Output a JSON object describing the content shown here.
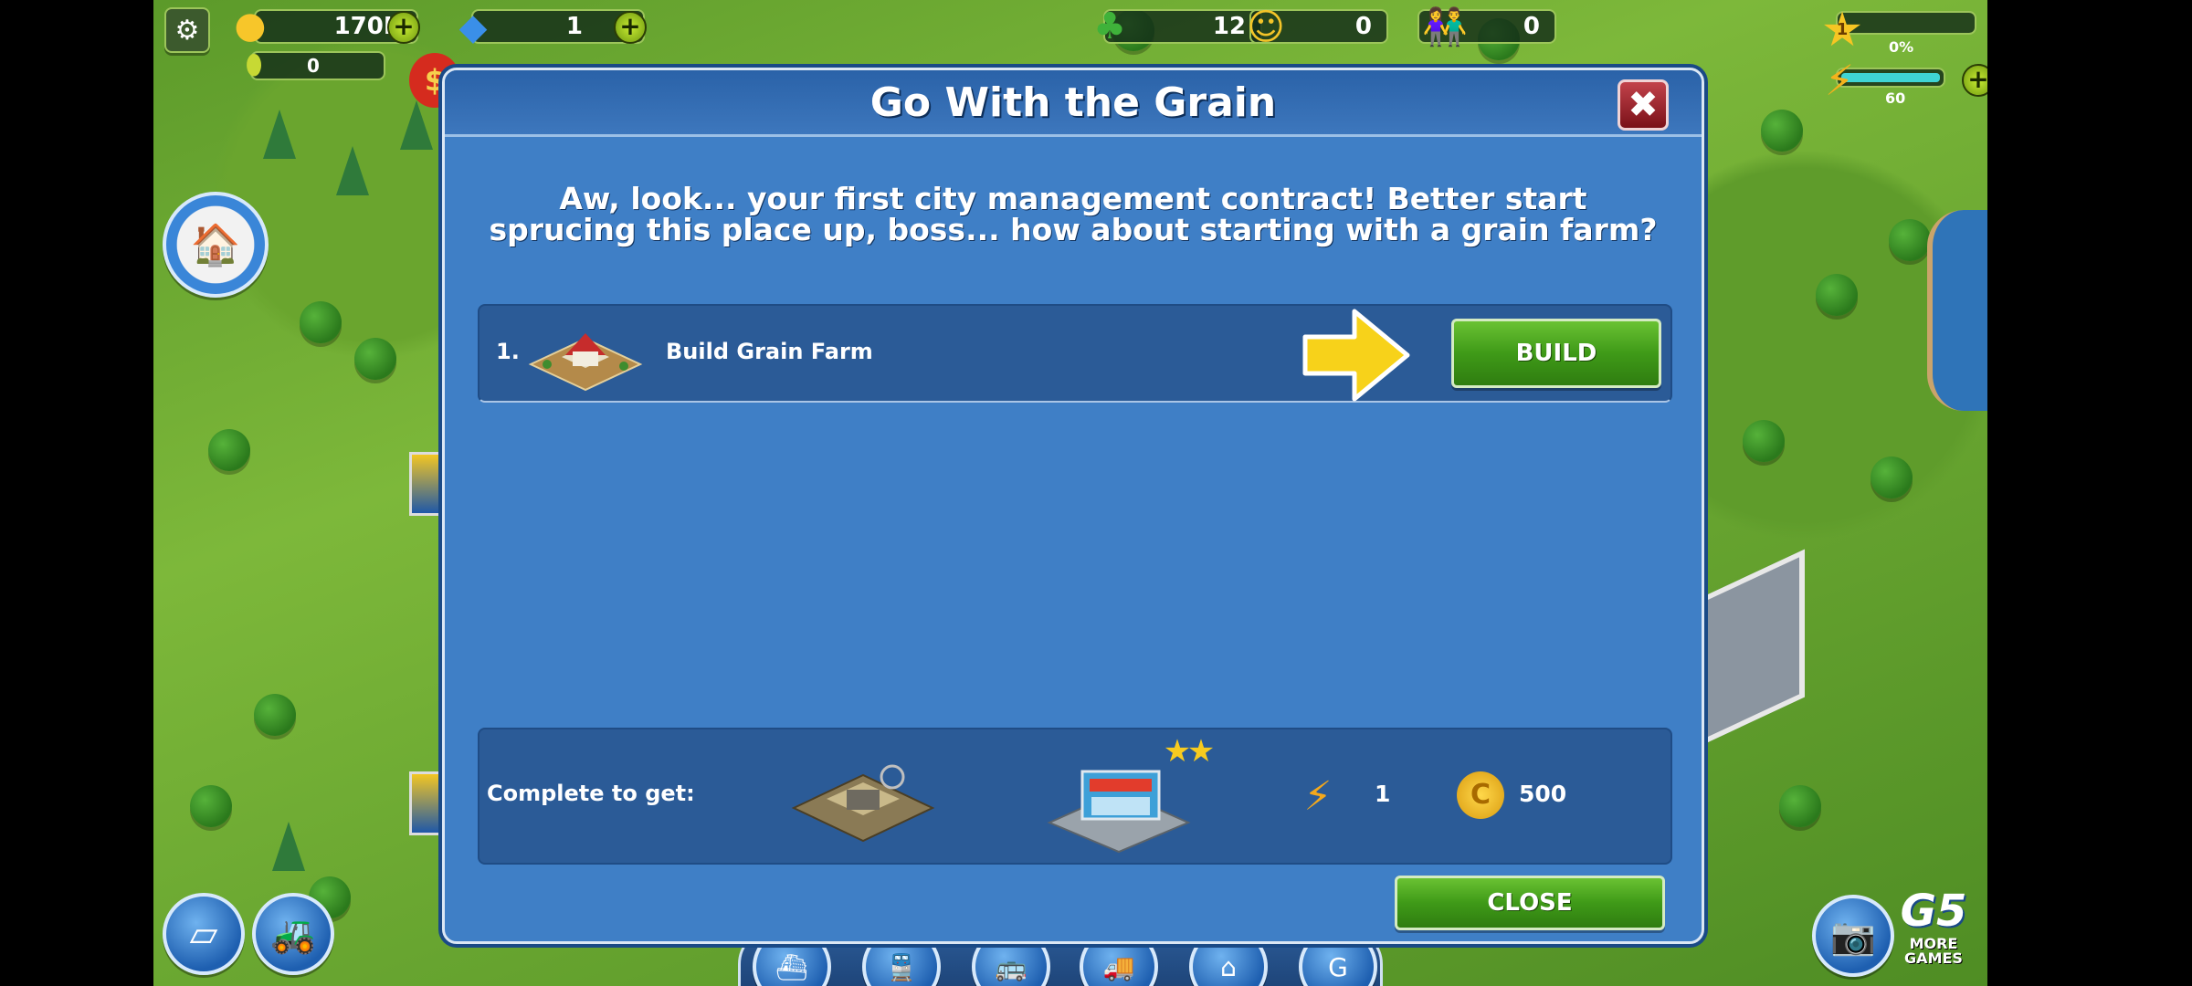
{
  "hud": {
    "coins": "170K",
    "gems": "1",
    "savings": "0",
    "trees": "12",
    "happiness": "0",
    "population": "0",
    "level_star": "1",
    "xp_percent": "0%",
    "xp_progress": 0,
    "energy": "60",
    "energy_progress": 1.0
  },
  "dialog": {
    "title": "Go With the Grain",
    "message": "Aw, look... your first city management contract! Better start sprucing this place up, boss... how about starting with a grain farm?",
    "tasks": [
      {
        "number": "1.",
        "label": "Build Grain Farm",
        "button": "BUILD"
      }
    ],
    "reward_label": "Complete to get:",
    "reward_energy": "1",
    "reward_coins": "500",
    "close_button": "CLOSE"
  },
  "branding": {
    "logo": "G5",
    "more_games": "MORE GAMES"
  },
  "colors": {
    "dialog_bg": "#3f7fc6",
    "button_green": "#3f9a18",
    "hud_text": "#ffffff"
  }
}
